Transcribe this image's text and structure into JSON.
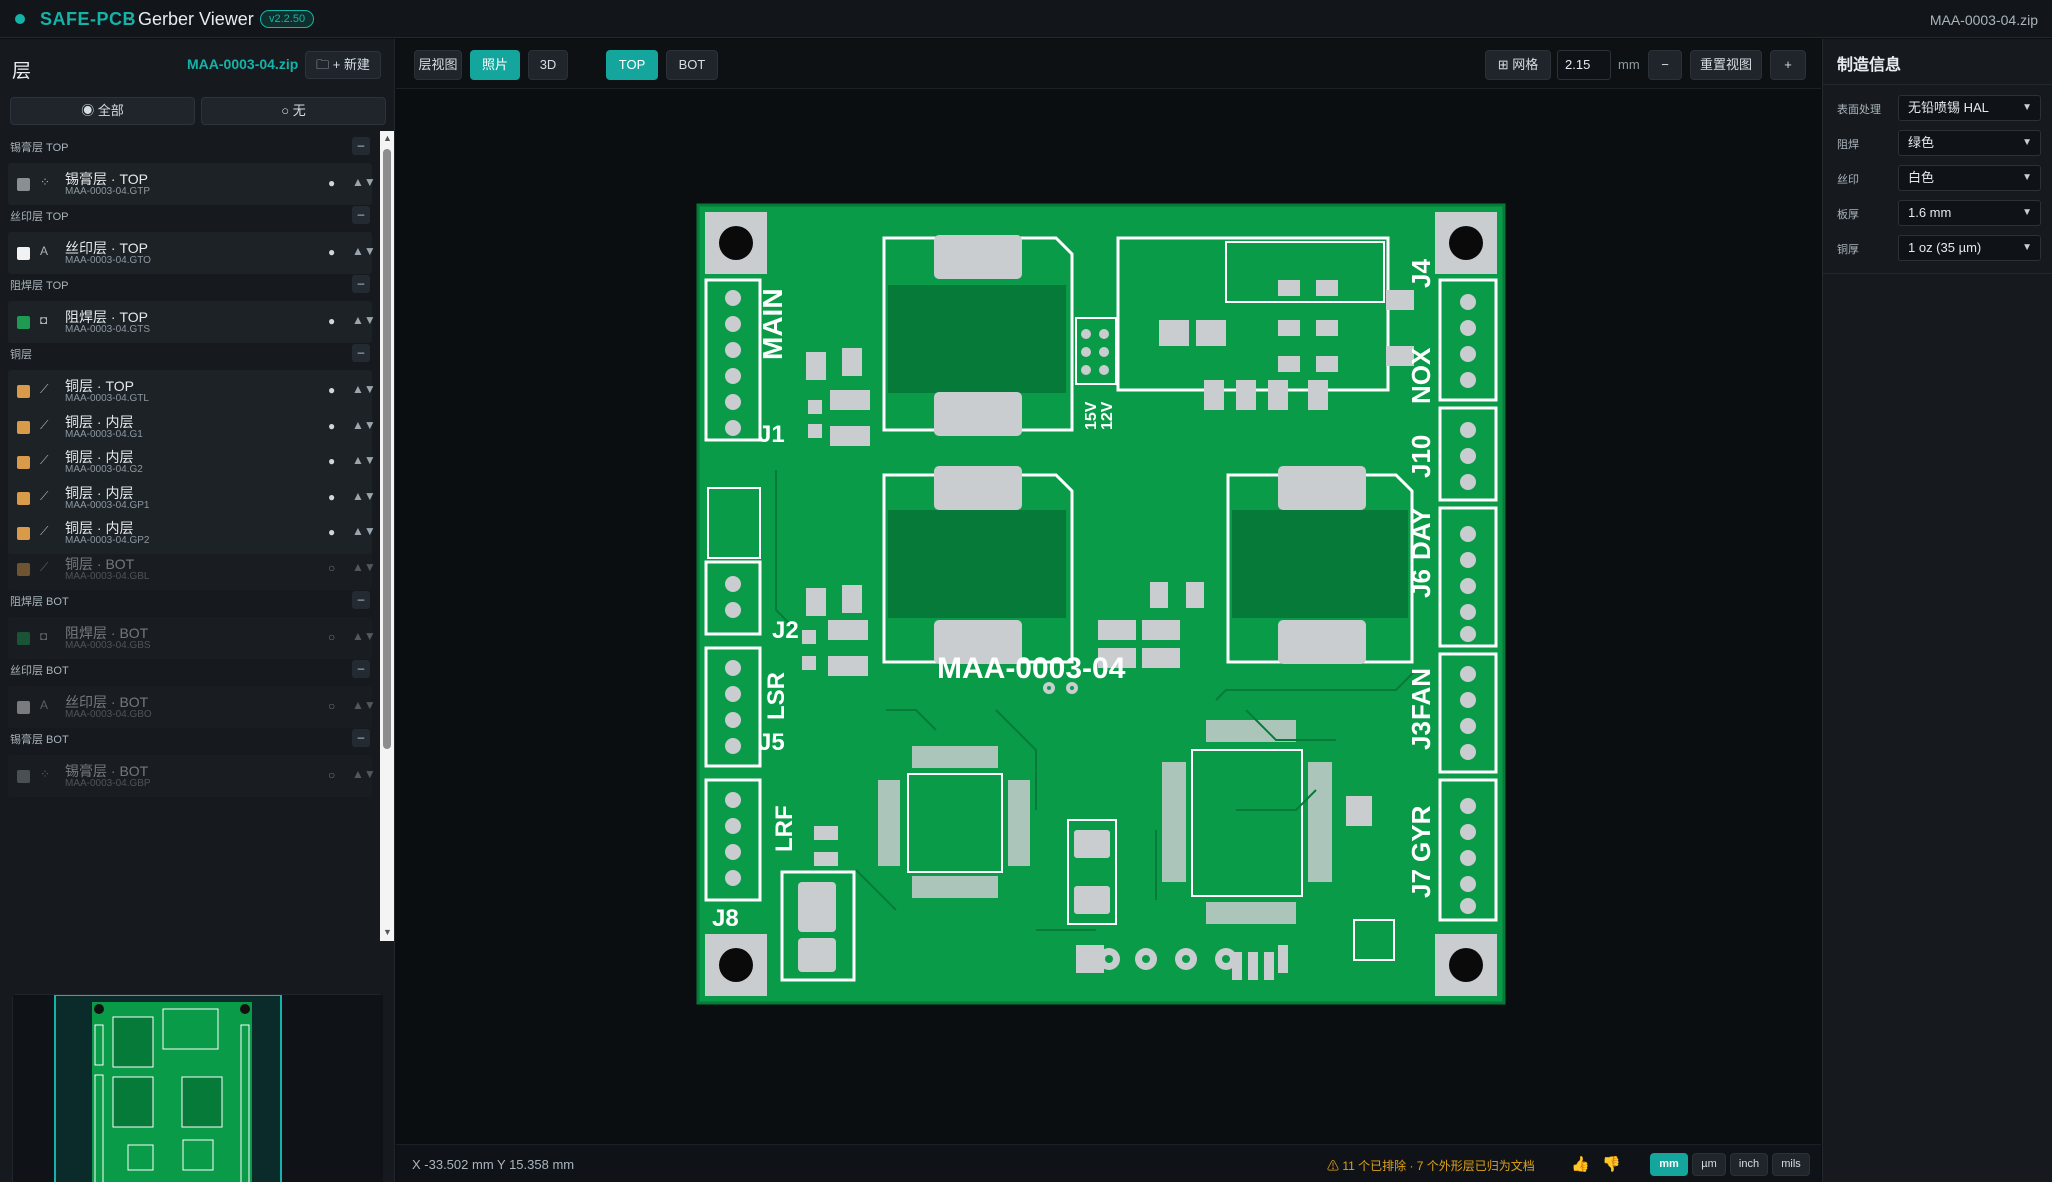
{
  "app": {
    "brand": "SAFE-PCB",
    "separator": "·",
    "title": "Gerber Viewer",
    "version": "v2.2.50",
    "file": "MAA-0003-04.zip"
  },
  "left": {
    "title": "层",
    "zip": "MAA-0003-04.zip",
    "new_button": "+ 新建",
    "all_button": "◉ 全部",
    "none_button": "○ 无",
    "groups": [
      {
        "name": "锡膏层 TOP",
        "collapse": "–",
        "layers": [
          {
            "name": "锡膏层 · TOP",
            "file": "MAA-0003-04.GTP",
            "color": "#8a8f93",
            "icon": "⁘",
            "vis": "●",
            "sort": "▲▼"
          }
        ]
      },
      {
        "name": "丝印层 TOP",
        "collapse": "–",
        "layers": [
          {
            "name": "丝印层 · TOP",
            "file": "MAA-0003-04.GTO",
            "color": "#f2f2f2",
            "icon": "A",
            "vis": "●",
            "sort": "▲▼"
          }
        ]
      },
      {
        "name": "阻焊层 TOP",
        "collapse": "–",
        "layers": [
          {
            "name": "阻焊层 · TOP",
            "file": "MAA-0003-04.GTS",
            "color": "#1f9a52",
            "icon": "◘",
            "vis": "●",
            "sort": "▲▼"
          }
        ]
      },
      {
        "name": "铜层",
        "collapse": "–",
        "layers": [
          {
            "name": "铜层 · TOP",
            "file": "MAA-0003-04.GTL",
            "color": "#d99a4a",
            "icon": "⟋",
            "vis": "●",
            "sort": "▲▼"
          },
          {
            "name": "铜层 · 内层",
            "file": "MAA-0003-04.G1",
            "color": "#d99a4a",
            "icon": "⟋",
            "vis": "●",
            "sort": "▲▼"
          },
          {
            "name": "铜层 · 内层",
            "file": "MAA-0003-04.G2",
            "color": "#d99a4a",
            "icon": "⟋",
            "vis": "●",
            "sort": "▲▼"
          },
          {
            "name": "铜层 · 内层",
            "file": "MAA-0003-04.GP1",
            "color": "#d99a4a",
            "icon": "⟋",
            "vis": "●",
            "sort": "▲▼"
          },
          {
            "name": "铜层 · 内层",
            "file": "MAA-0003-04.GP2",
            "color": "#d99a4a",
            "icon": "⟋",
            "vis": "●",
            "sort": "▲▼"
          },
          {
            "name": "铜层 · BOT",
            "file": "MAA-0003-04.GBL",
            "color": "#d99a4a",
            "icon": "⟋",
            "vis": "○",
            "sort": "▲▼",
            "dim": true
          }
        ]
      },
      {
        "name": "阻焊层 BOT",
        "collapse": "–",
        "layers": [
          {
            "name": "阻焊层 · BOT",
            "file": "MAA-0003-04.GBS",
            "color": "#1f9a52",
            "icon": "◘",
            "vis": "○",
            "sort": "▲▼",
            "dim": true
          }
        ]
      },
      {
        "name": "丝印层 BOT",
        "collapse": "–",
        "layers": [
          {
            "name": "丝印层 · BOT",
            "file": "MAA-0003-04.GBO",
            "color": "#f2f2f2",
            "icon": "A",
            "vis": "○",
            "sort": "▲▼",
            "dim": true
          }
        ]
      },
      {
        "name": "锡膏层 BOT",
        "collapse": "–",
        "layers": [
          {
            "name": "锡膏层 · BOT",
            "file": "MAA-0003-04.GBP",
            "color": "#8a8f93",
            "icon": "⁘",
            "vis": "○",
            "sort": "▲▼",
            "dim": true
          }
        ]
      }
    ]
  },
  "toolbar": {
    "layer_view": "层视图",
    "photo": "照片",
    "three_d": "3D",
    "top": "TOP",
    "bot": "BOT",
    "grid": "⊞ 网格",
    "zoom_value": "2.15",
    "zoom_unit": "mm",
    "zoom_out": "−",
    "reset_view": "重置视图",
    "zoom_in": "+"
  },
  "board": {
    "name_label": "MAA-0003-04",
    "labels": [
      "MAIN",
      "J1",
      "J2",
      "J5",
      "LSR",
      "LRF",
      "J8",
      "J4",
      "NOX",
      "J10",
      "DAY",
      "J6",
      "FAN",
      "J3",
      "GYR",
      "J7",
      "15V",
      "12V"
    ]
  },
  "status": {
    "coords": "X -33.502 mm Y 15.358 mm",
    "warning": "⚠ 11 个已排除 · 7 个外形层已归为文档",
    "thumbs_up": "👍",
    "thumbs_down": "👎",
    "units": [
      "mm",
      "µm",
      "inch",
      "mils"
    ],
    "active_unit": "mm"
  },
  "fab": {
    "title": "制造信息",
    "props": [
      {
        "label": "表面处理",
        "value": "无铅喷锡 HAL"
      },
      {
        "label": "阻焊",
        "value": "绿色"
      },
      {
        "label": "丝印",
        "value": "白色"
      },
      {
        "label": "板厚",
        "value": "1.6 mm"
      },
      {
        "label": "铜厚",
        "value": "1 oz (35 µm)"
      }
    ]
  },
  "colors": {
    "accent": "#14a69c",
    "board": "#0a9b48",
    "copper_pour": "#067a38",
    "silk": "#ffffff",
    "pad": "#c9cdd0"
  }
}
